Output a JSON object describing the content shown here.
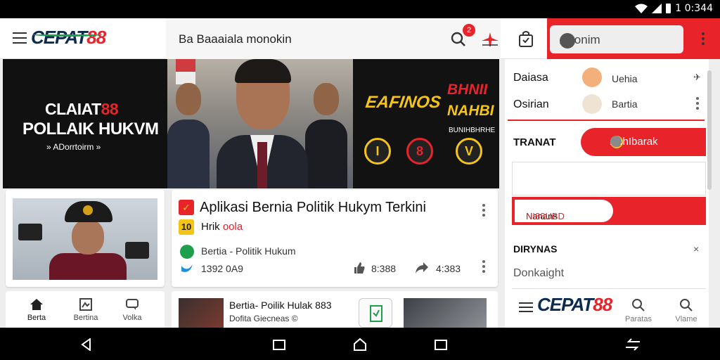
{
  "status_bar": {
    "time": "1 0:344"
  },
  "header": {
    "logo_part1": "CEPAT",
    "logo_part2": "88",
    "search_text": "Ba Baaaiala monokin",
    "notification_count": "2",
    "right_input_text": "Aoonim"
  },
  "hero": {
    "left_line1_a": "CLAIAT",
    "left_line1_b": "88",
    "left_line2": "POLLAIK HUKVM",
    "left_line3": "» ADorrtoirm »",
    "right_text1": "EAFINOS",
    "right_text2": "BHNII",
    "right_text3": "NAHBI",
    "right_text4": "BUNIHBHRHE",
    "right_badge1": "I",
    "right_badge2": "8",
    "right_badge3": "V"
  },
  "article": {
    "title": "Aplikasi Bernia Politik Hukym Terkini",
    "badge2": "10",
    "sub_black": "Hrik",
    "sub_red": "oola",
    "category": "Bertia - Politik Hukum",
    "time": "1392 0A9",
    "likes": "8:388",
    "shares": "4:383"
  },
  "bottom_nav_left": [
    {
      "label": "Berta"
    },
    {
      "label": "Bertina"
    },
    {
      "label": "Volka"
    }
  ],
  "bottom_card": {
    "title": "Bertia- Poilik Hulak 883",
    "meta": "Dofita Giecneas ©"
  },
  "right_panel": {
    "row1_label": "Daiasa",
    "row1_value": "Uehia",
    "row2_label": "Osirian",
    "row2_value": "Bartia",
    "transit_label": "TRANAT",
    "pill_text": "AchIbarak",
    "button_text_black": "Nanans",
    "button_text_red": "NI88UBD",
    "section_title": "DIRYNAS",
    "section_close": "×",
    "section_sub": "Donkaight"
  },
  "right_bottom_nav": [
    {
      "label": "Paratas"
    },
    {
      "label": "Vlame"
    }
  ],
  "colors": {
    "accent_red": "#e8232a",
    "brand_navy": "#0d2b4e",
    "brand_yellow": "#f4c417",
    "brand_green": "#1d9f4c"
  }
}
